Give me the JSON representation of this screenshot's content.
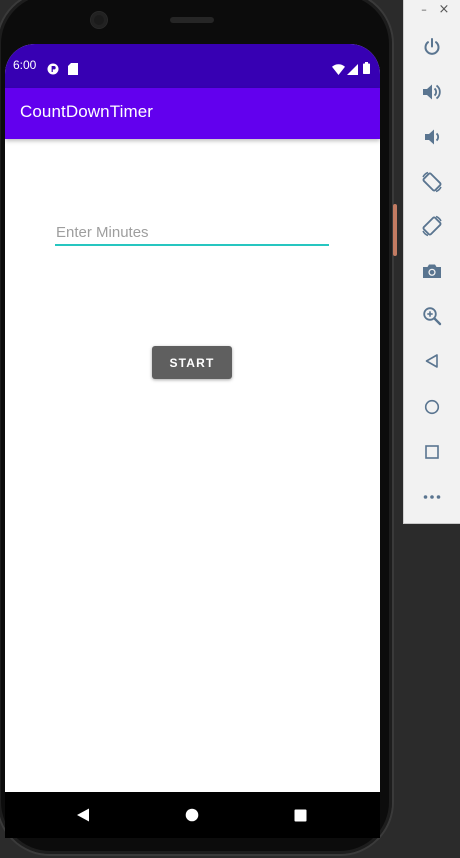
{
  "status_bar": {
    "time": "6:00",
    "icons": [
      "notification-p-icon",
      "sd-card-icon",
      "wifi-icon",
      "signal-icon",
      "battery-icon"
    ]
  },
  "app_bar": {
    "title": "CountDownTimer"
  },
  "minutes_input": {
    "value": "",
    "placeholder": "Enter Minutes"
  },
  "start_button": {
    "label": "START"
  },
  "nav_bar": {
    "buttons": [
      "back-icon",
      "home-icon",
      "recents-icon"
    ]
  },
  "emulator_toolbar": {
    "window_controls": {
      "minimize": "–",
      "close": "×"
    },
    "buttons": [
      "power-icon",
      "volume-up-icon",
      "volume-down-icon",
      "rotate-left-icon",
      "rotate-right-icon",
      "camera-icon",
      "zoom-icon",
      "back-icon",
      "home-icon",
      "overview-icon",
      "more-icon"
    ]
  },
  "colors": {
    "status_bar": "#3700b3",
    "app_bar": "#6200ee",
    "input_underline": "#26c6c0",
    "button": "#5f5f5f",
    "toolbar_icon": "#5a7590"
  }
}
